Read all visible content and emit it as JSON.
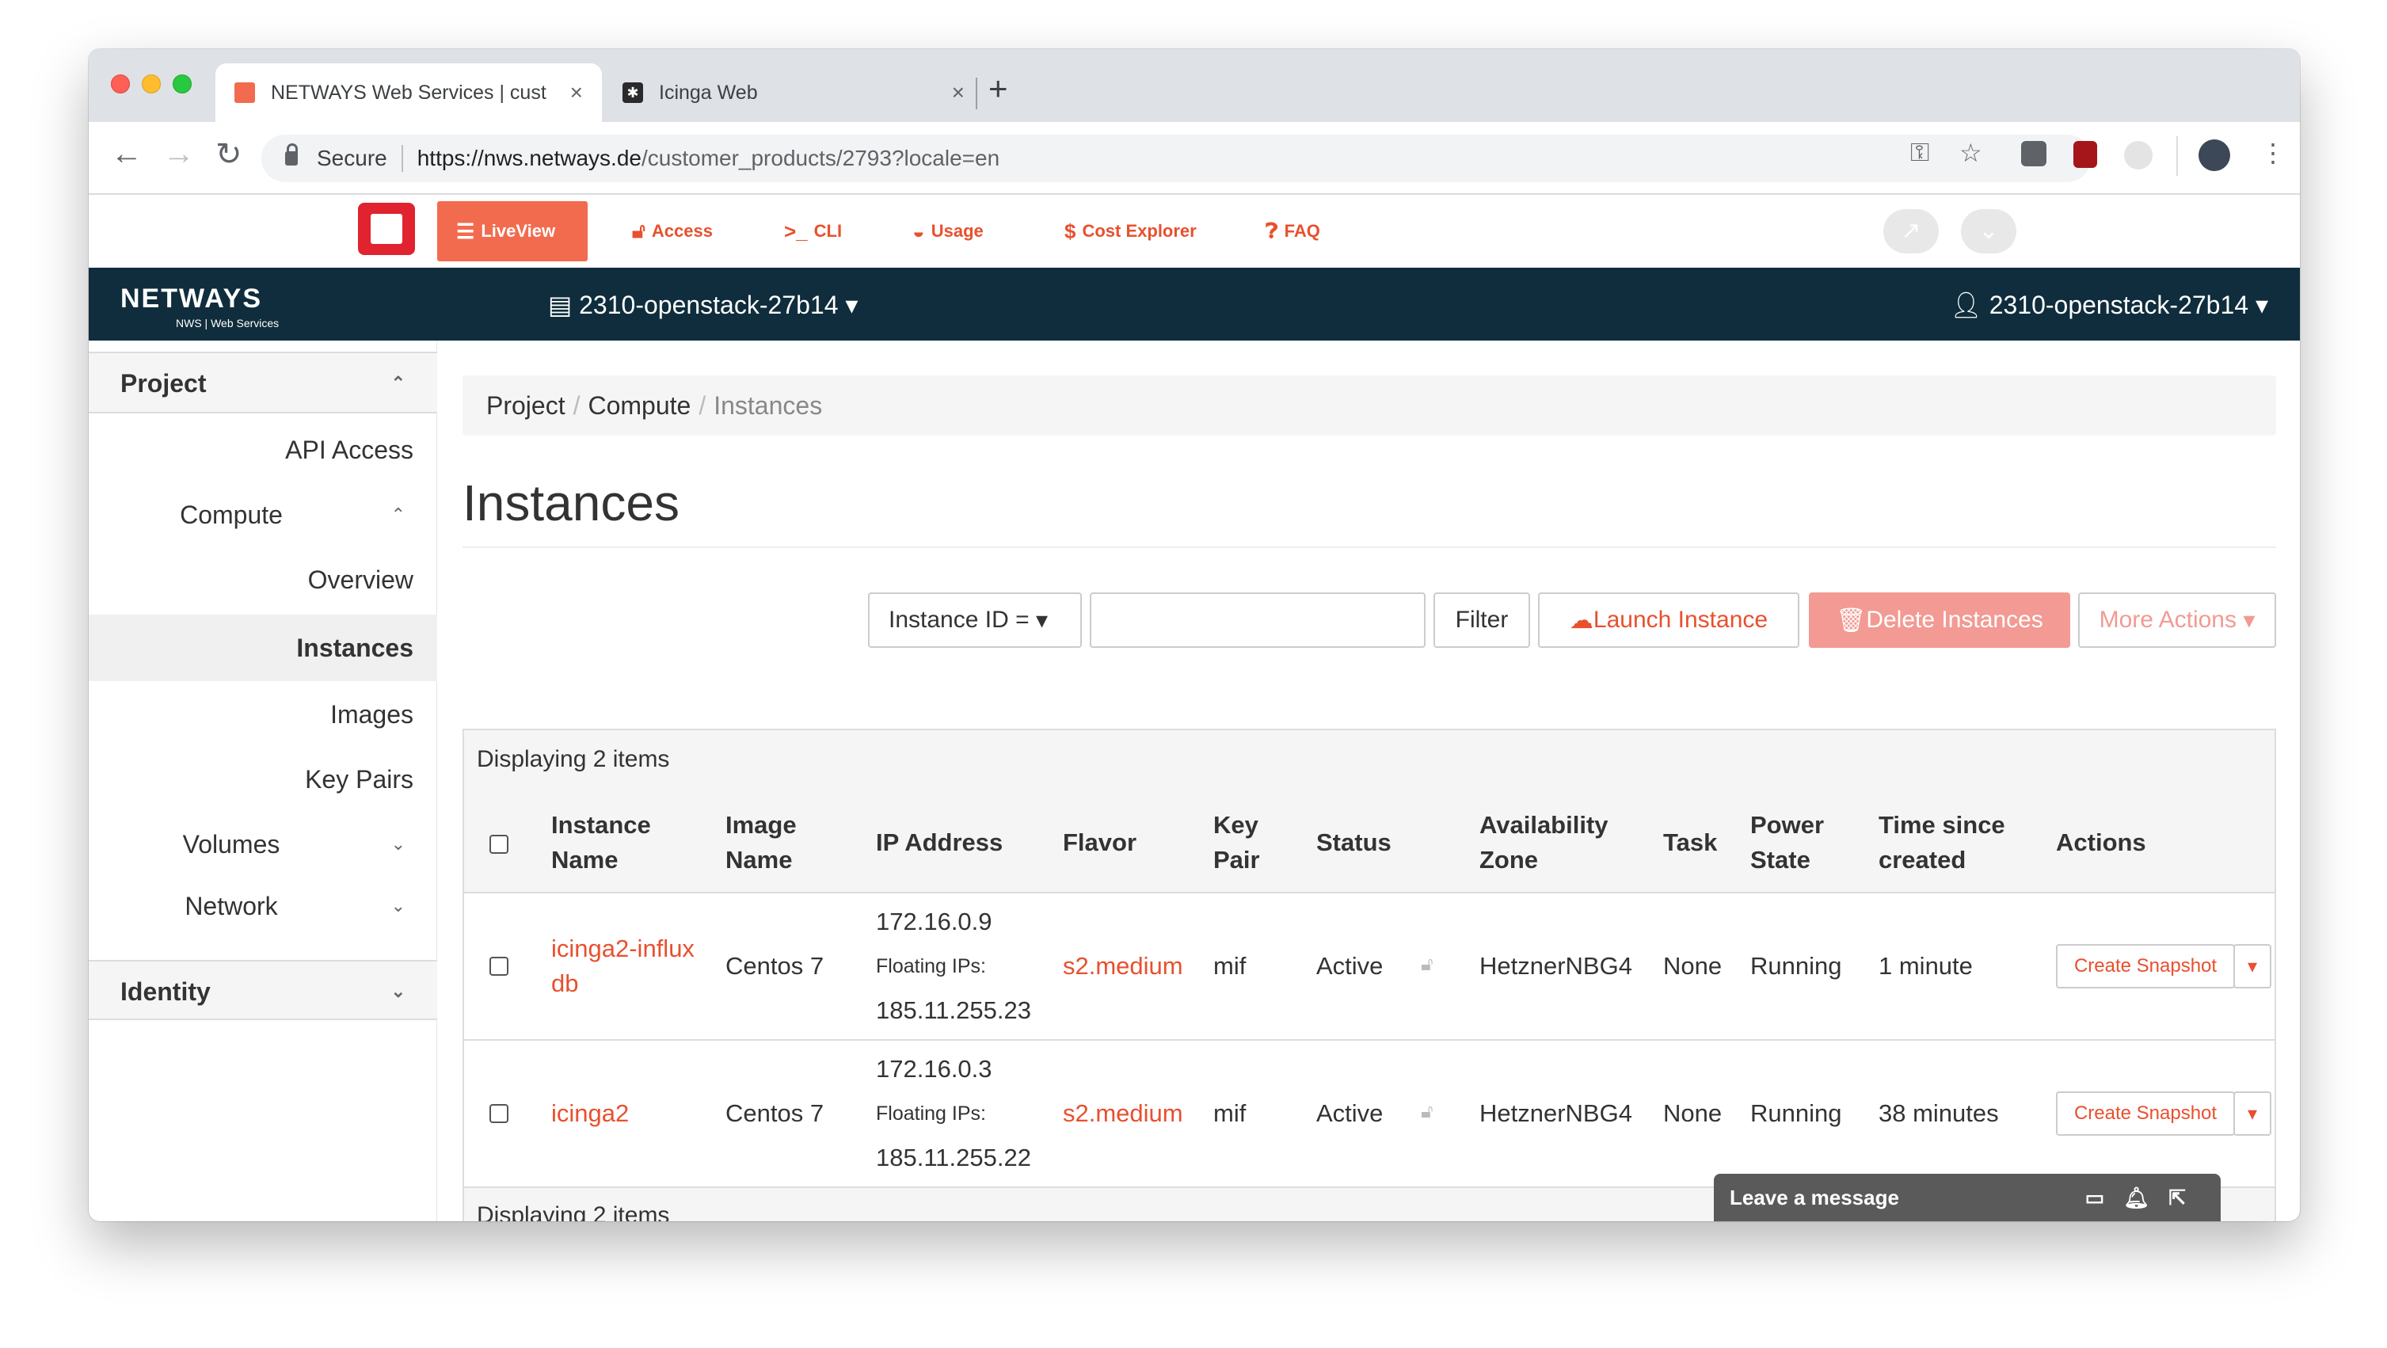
{
  "browser": {
    "tabs": [
      {
        "title": "NETWAYS Web Services | cust",
        "active": true
      },
      {
        "title": "Icinga Web",
        "active": false
      }
    ],
    "secure_label": "Secure",
    "url_host": "https://nws.netways.de",
    "url_path": "/customer_products/2793?locale=en",
    "icons": [
      "back-icon",
      "forward-icon",
      "reload-icon",
      "lock-icon",
      "key-icon",
      "star-icon",
      "extension-gear-icon",
      "ublock-icon",
      "extension-icon",
      "profile-avatar",
      "menu-icon"
    ]
  },
  "toolbar": {
    "items": [
      {
        "label": "LiveView",
        "icon": "list-icon"
      },
      {
        "label": "Access",
        "icon": "unlock-icon"
      },
      {
        "label": "CLI",
        "icon": "terminal-icon"
      },
      {
        "label": "Usage",
        "icon": "dashboard-icon"
      },
      {
        "label": "Cost Explorer",
        "icon": "dollar-icon"
      },
      {
        "label": "FAQ",
        "icon": "question-icon"
      }
    ]
  },
  "header": {
    "brand": "NETWAYS",
    "brand_sub": "NWS | Web Services",
    "project": "2310-openstack-27b14",
    "user": "2310-openstack-27b14"
  },
  "sidebar": {
    "project_label": "Project",
    "items": [
      {
        "label": "API Access"
      },
      {
        "label": "Compute"
      },
      {
        "label": "Overview"
      },
      {
        "label": "Instances"
      },
      {
        "label": "Images"
      },
      {
        "label": "Key Pairs"
      },
      {
        "label": "Volumes"
      },
      {
        "label": "Network"
      }
    ],
    "identity_label": "Identity"
  },
  "main": {
    "breadcrumb": [
      "Project",
      "Compute",
      "Instances"
    ],
    "title": "Instances",
    "filter_select": "Instance ID =",
    "filter_value": "",
    "filter_button": "Filter",
    "launch_button": "Launch Instance",
    "delete_button": "Delete Instances",
    "more_button": "More Actions",
    "display_count": "Displaying 2 items",
    "columns": [
      [
        "Instance",
        "Name"
      ],
      [
        "Image",
        "Name"
      ],
      [
        "IP Address"
      ],
      [
        "Flavor"
      ],
      [
        "Key",
        "Pair"
      ],
      [
        "Status"
      ],
      [
        "Availability",
        "Zone"
      ],
      [
        "Task"
      ],
      [
        "Power",
        "State"
      ],
      [
        "Time since",
        "created"
      ],
      [
        "Actions"
      ]
    ],
    "rows": [
      {
        "name_line1": "icinga2-influx",
        "name_line2": "db",
        "image": "Centos 7",
        "ip": "172.16.0.9",
        "floating_label": "Floating IPs:",
        "floating_ip": "185.11.255.23",
        "flavor": "s2.medium",
        "key_pair": "mif",
        "status": "Active",
        "zone": "HetznerNBG4",
        "task": "None",
        "power": "Running",
        "time": "1 minute",
        "action": "Create Snapshot"
      },
      {
        "name_line1": "icinga2",
        "name_line2": "",
        "image": "Centos 7",
        "ip": "172.16.0.3",
        "floating_label": "Floating IPs:",
        "floating_ip": "185.11.255.22",
        "flavor": "s2.medium",
        "key_pair": "mif",
        "status": "Active",
        "zone": "HetznerNBG4",
        "task": "None",
        "power": "Running",
        "time": "38 minutes",
        "action": "Create Snapshot"
      }
    ]
  },
  "chat": {
    "label": "Leave a message"
  },
  "colors": {
    "accent": "#e8502e",
    "navy": "#0f2d3c",
    "danger": "#f29a93"
  }
}
